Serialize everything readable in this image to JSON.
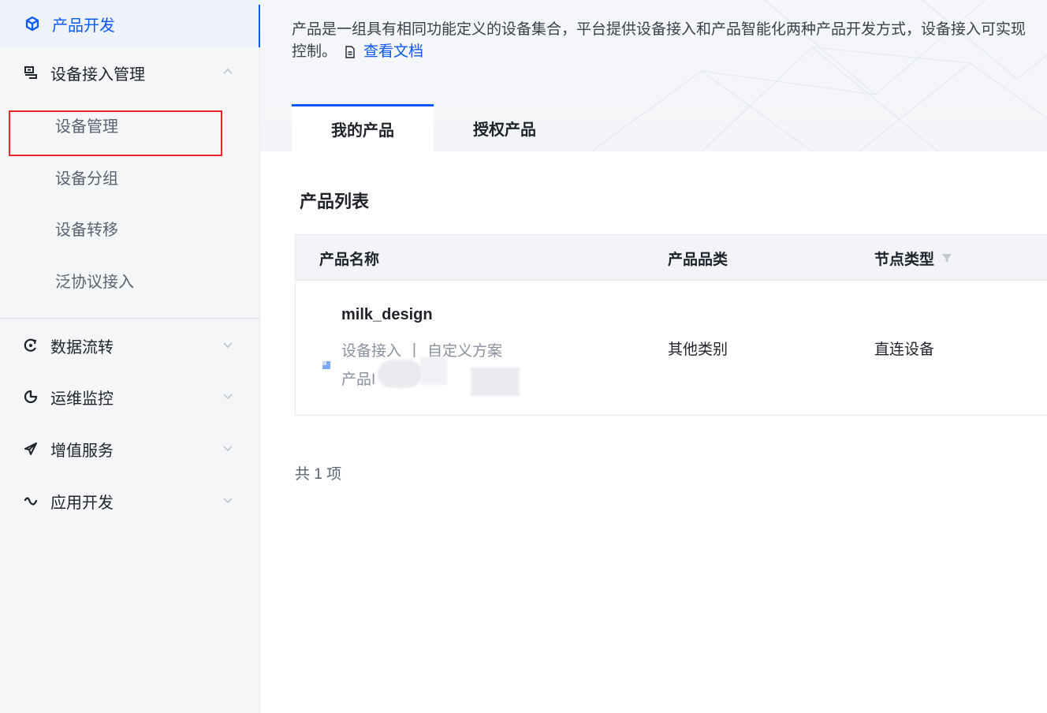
{
  "sidebar": {
    "top_item": {
      "label": "产品开发",
      "icon": "cube-icon"
    },
    "group_access": {
      "label": "设备接入管理",
      "icon": "device-access-icon"
    },
    "sub_items": [
      {
        "label": "设备管理"
      },
      {
        "label": "设备分组"
      },
      {
        "label": "设备转移"
      },
      {
        "label": "泛协议接入"
      }
    ],
    "groups": [
      {
        "label": "数据流转",
        "icon": "data-flow-icon"
      },
      {
        "label": "运维监控",
        "icon": "monitor-icon"
      },
      {
        "label": "增值服务",
        "icon": "send-icon"
      },
      {
        "label": "应用开发",
        "icon": "app-dev-icon"
      }
    ]
  },
  "main": {
    "description": "产品是一组具有相同功能定义的设备集合，平台提供设备接入和产品智能化两种产品开发方式，设备接入可实现",
    "description_line2": "控制。",
    "doc_link": "查看文档",
    "tabs": [
      {
        "label": "我的产品"
      },
      {
        "label": "授权产品"
      }
    ],
    "section_title": "产品列表",
    "table": {
      "columns": [
        "产品名称",
        "产品品类",
        "节点类型"
      ],
      "rows": [
        {
          "name": "milk_design",
          "access": "设备接入",
          "scheme": "自定义方案",
          "id_label": "产品I",
          "category": "其他类别",
          "node_type": "直连设备"
        }
      ]
    },
    "total": "共 1 项"
  },
  "colors": {
    "accent": "#0a58f6",
    "highlight": "#e5262b"
  }
}
